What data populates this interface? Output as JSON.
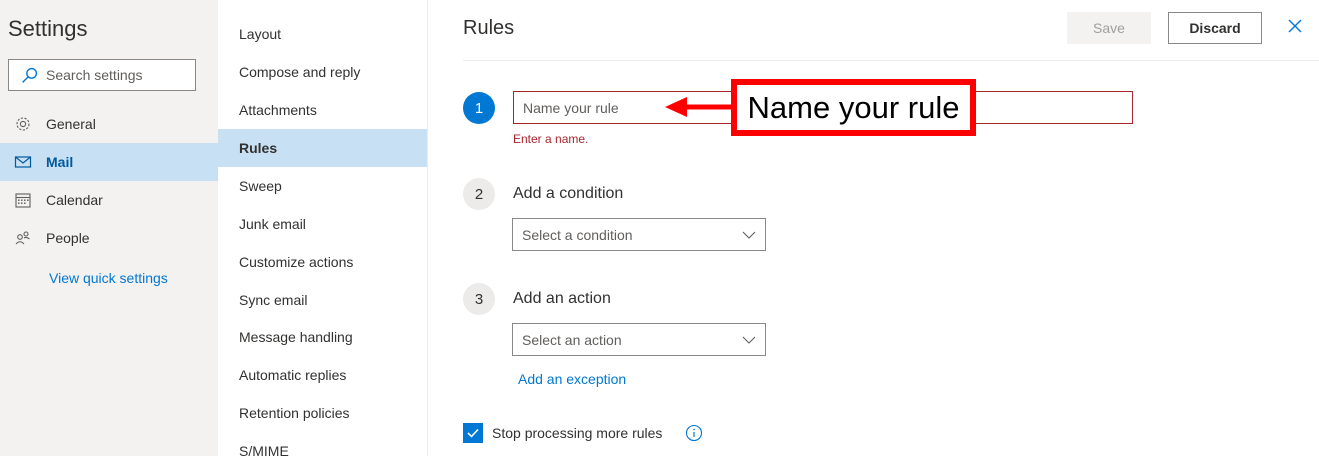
{
  "sidebar": {
    "title": "Settings",
    "search_placeholder": "Search settings",
    "items": [
      {
        "label": "General",
        "icon": "gear-icon"
      },
      {
        "label": "Mail",
        "icon": "mail-icon"
      },
      {
        "label": "Calendar",
        "icon": "calendar-icon"
      },
      {
        "label": "People",
        "icon": "people-icon"
      }
    ],
    "selected": "Mail",
    "quick_settings_link": "View quick settings"
  },
  "categories": {
    "items": [
      "Layout",
      "Compose and reply",
      "Attachments",
      "Rules",
      "Sweep",
      "Junk email",
      "Customize actions",
      "Sync email",
      "Message handling",
      "Automatic replies",
      "Retention policies",
      "S/MIME"
    ],
    "selected": "Rules"
  },
  "rules_panel": {
    "title": "Rules",
    "save_label": "Save",
    "discard_label": "Discard",
    "step1": {
      "number": "1",
      "placeholder": "Name your rule",
      "error": "Enter a name."
    },
    "step2": {
      "number": "2",
      "label": "Add a condition",
      "dropdown": "Select a condition"
    },
    "step3": {
      "number": "3",
      "label": "Add an action",
      "dropdown": "Select an action"
    },
    "exception_link": "Add an exception",
    "stop_processing_label": "Stop processing more rules",
    "stop_processing_checked": true
  },
  "annotation": {
    "callout_text": "Name your rule",
    "color": "#ff0000"
  },
  "colors": {
    "accent": "#0078d4",
    "selected_bg": "#c7e0f4",
    "error": "#a4262c"
  }
}
